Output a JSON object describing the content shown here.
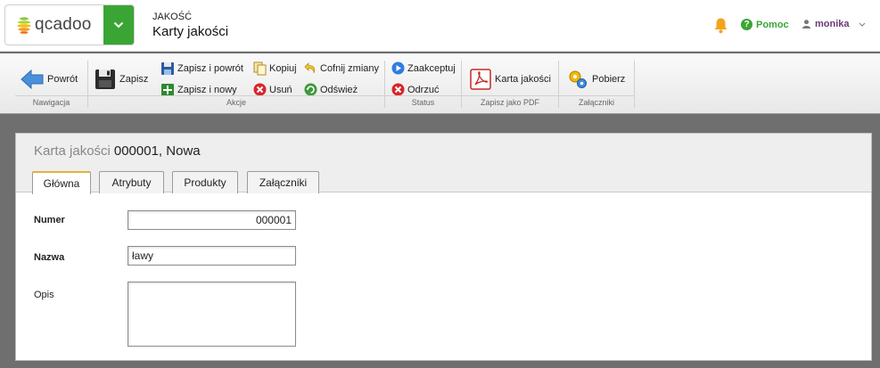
{
  "header": {
    "logo_text": "qcadoo",
    "module": "JAKOŚĆ",
    "page": "Karty jakości",
    "help_label": "Pomoc",
    "help_icon_glyph": "?",
    "user_name": "monika",
    "brand_color": "#3aa535"
  },
  "ribbon": {
    "groups": {
      "navigation": "Nawigacja",
      "actions": "Akcje",
      "status": "Status",
      "pdf": "Zapisz jako PDF",
      "attachments": "Załączniki"
    },
    "buttons": {
      "back": "Powrót",
      "save": "Zapisz",
      "save_back": "Zapisz i powrót",
      "save_new": "Zapisz i nowy",
      "copy": "Kopiuj",
      "delete": "Usuń",
      "undo": "Cofnij zmiany",
      "refresh": "Odśwież",
      "accept": "Zaakceptuj",
      "reject": "Odrzuć",
      "quality_card": "Karta jakości",
      "download": "Pobierz"
    }
  },
  "form": {
    "title_label": "Karta jakości",
    "title_value": "000001, Nowa",
    "tabs": [
      "Główna",
      "Atrybuty",
      "Produkty",
      "Załączniki"
    ],
    "fields": {
      "number": {
        "label": "Numer",
        "value": "000001"
      },
      "name": {
        "label": "Nazwa",
        "value": "ławy"
      },
      "description": {
        "label": "Opis",
        "value": ""
      }
    }
  }
}
